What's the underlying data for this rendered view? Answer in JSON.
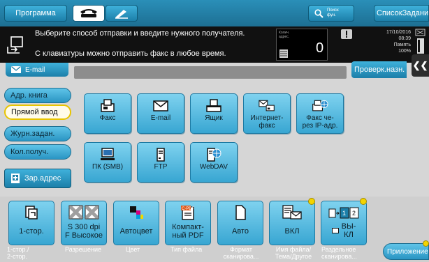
{
  "topbar": {
    "program_label": "Программа",
    "search_label_line1": "Поиск",
    "search_label_line2": "фун.",
    "joblist_label": "СписокЗаданий"
  },
  "message": {
    "line1": "Выберите способ отправки и введите нужного получателя.",
    "line2": "С клавиатуры можно отправить факс в любое время."
  },
  "counter": {
    "label_line1": "Колич.",
    "label_line2": "адрес.",
    "value": "0"
  },
  "status": {
    "date": "17/10/2016",
    "time": "08:39",
    "memory_label": "Память",
    "memory_value": "100%"
  },
  "address_bar": {
    "email_tab": "E-mail",
    "check_button": "Проверк.назн."
  },
  "nav": {
    "items": [
      {
        "label": "Адр. книга"
      },
      {
        "label": "Прямой ввод"
      },
      {
        "label": "Журн.задан."
      },
      {
        "label": "Кол.получ."
      }
    ],
    "register_label": "Зар.адрес"
  },
  "tiles": [
    {
      "label": "Факс",
      "icon": "fax-icon"
    },
    {
      "label": "E-mail",
      "icon": "envelope-icon"
    },
    {
      "label": "Ящик",
      "icon": "box-icon"
    },
    {
      "label": "Интернет-\nфакс",
      "icon": "internet-fax-icon"
    },
    {
      "label": "Факс че-\nрез IP-адр.",
      "icon": "ip-fax-icon"
    },
    {
      "label": "ПК (SMB)",
      "icon": "computer-icon"
    },
    {
      "label": "FTP",
      "icon": "ftp-icon"
    },
    {
      "label": "WebDAV",
      "icon": "webdav-icon"
    }
  ],
  "settings": [
    {
      "value": "1-стор.",
      "caption": "1-стор./\n2-стор."
    },
    {
      "value": "S 300 dpi\nF Высокое",
      "caption": "Разрешение"
    },
    {
      "value": "Автоцвет",
      "caption": "Цвет"
    },
    {
      "value": "Компакт-\nный PDF",
      "caption": "Тип файла"
    },
    {
      "value": "Авто",
      "caption": "Формат\nсканирова..."
    },
    {
      "value": "ВКЛ",
      "caption": "Имя файла/\nТема/Другое"
    },
    {
      "value": "ВЫ-\nКЛ",
      "caption": "Раздельное\nсканирова..."
    }
  ],
  "apps_label": "Приложение",
  "colors": {
    "accent": "#2a95c3",
    "active_border": "#e8c400",
    "badge": "#f4d400"
  }
}
